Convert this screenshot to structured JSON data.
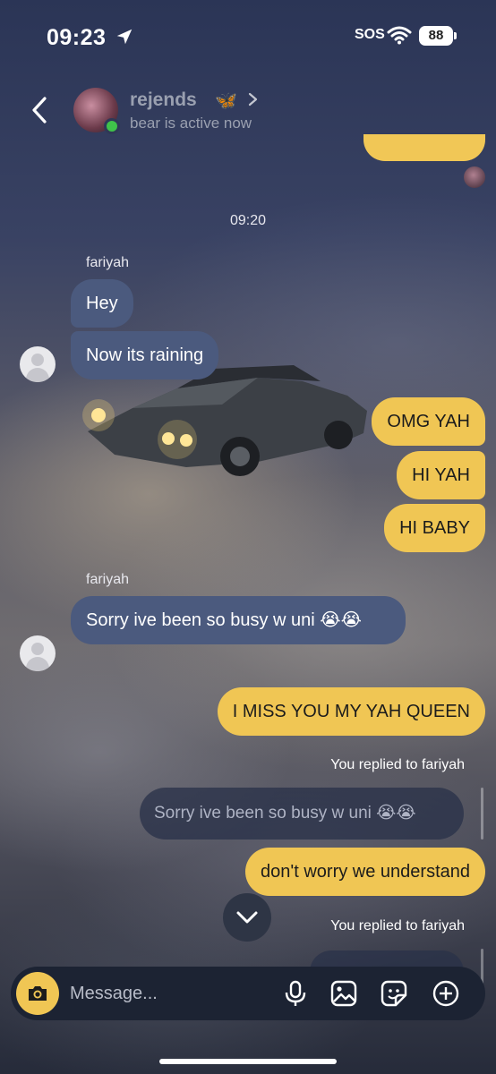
{
  "status_bar": {
    "time": "09:23",
    "sos": "SOS",
    "battery": "88",
    "icons": [
      "location-arrow-icon",
      "wifi-icon",
      "battery-icon"
    ]
  },
  "header": {
    "title": "rejends",
    "title_emoji": "🦋",
    "subtitle": "bear is active now",
    "icons": [
      "back-icon",
      "chevron-right-icon"
    ]
  },
  "chat": {
    "timestamp": "09:20",
    "group1": {
      "sender": "fariyah",
      "messages": [
        "Hey",
        "Now its raining"
      ]
    },
    "outgoing1": [
      "OMG YAH",
      "HI YAH",
      "HI BABY"
    ],
    "group2": {
      "sender": "fariyah",
      "message": "Sorry ive been so busy w uni 😭😭"
    },
    "outgoing2": "I MISS YOU MY YAH QUEEN",
    "reply1": {
      "label": "You replied to fariyah",
      "quoted": "Sorry ive been so busy w uni 😭😭",
      "message": "don't worry we understand"
    },
    "reply2": {
      "label": "You replied to fariyah"
    }
  },
  "composer": {
    "placeholder": "Message...",
    "icons": [
      "camera-icon",
      "microphone-icon",
      "image-icon",
      "sticker-icon",
      "plus-icon"
    ]
  },
  "colors": {
    "outgoing_bubble": "#f0c654",
    "incoming_bubble": "#4b5a7e",
    "active_dot": "#3fc24a"
  }
}
